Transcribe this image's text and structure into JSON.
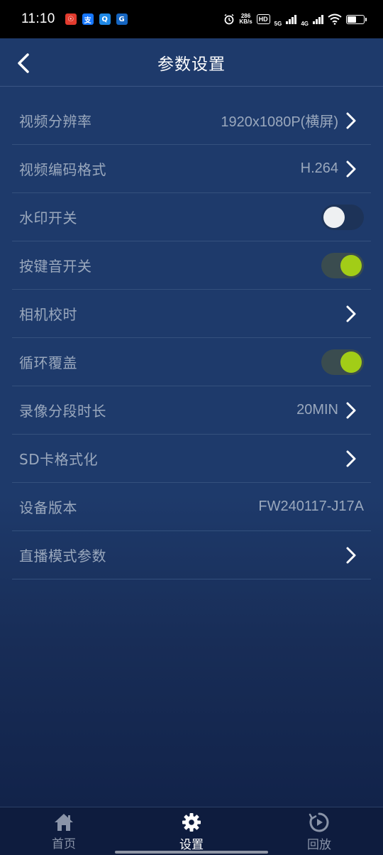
{
  "status_bar": {
    "time": "11:10",
    "network_speed_top": "286",
    "network_speed_unit": "KB/s",
    "hd_label": "HD",
    "net1": "5G",
    "net2": "4G",
    "app_icons": [
      {
        "name": "app-icon-red",
        "glyph": "☉",
        "color": "#e23b2e"
      },
      {
        "name": "alipay-icon",
        "glyph": "支",
        "color": "#1677ff"
      },
      {
        "name": "app-icon-search",
        "glyph": "Q",
        "color": "#1e88e5"
      },
      {
        "name": "app-icon-blue",
        "glyph": "G",
        "color": "#1565c0"
      }
    ]
  },
  "header": {
    "title": "参数设置"
  },
  "settings": [
    {
      "label": "视频分辨率",
      "value": "1920x1080P(横屏)",
      "control": "chevron"
    },
    {
      "label": "视频编码格式",
      "value": "H.264",
      "control": "chevron"
    },
    {
      "label": "水印开关",
      "value": "",
      "control": "toggle",
      "on": false
    },
    {
      "label": "按键音开关",
      "value": "",
      "control": "toggle",
      "on": true
    },
    {
      "label": "相机校时",
      "value": "",
      "control": "chevron"
    },
    {
      "label": "循环覆盖",
      "value": "",
      "control": "toggle",
      "on": true
    },
    {
      "label": "录像分段时长",
      "value": "20MIN",
      "control": "chevron"
    },
    {
      "label": "SD卡格式化",
      "value": "",
      "control": "chevron"
    },
    {
      "label": "设备版本",
      "value": "FW240117-J17A",
      "control": "none"
    },
    {
      "label": "直播模式参数",
      "value": "",
      "control": "chevron"
    }
  ],
  "bottom_nav": {
    "items": [
      {
        "label": "首页",
        "icon": "home-icon",
        "active": false
      },
      {
        "label": "设置",
        "icon": "gear-icon",
        "active": true
      },
      {
        "label": "回放",
        "icon": "playback-icon",
        "active": false
      }
    ]
  },
  "colors": {
    "toggle_on": "#a2cd17",
    "toggle_off_knob": "#eef0f2",
    "text_muted": "#9aa8bd",
    "background": "#1e3a6b"
  }
}
